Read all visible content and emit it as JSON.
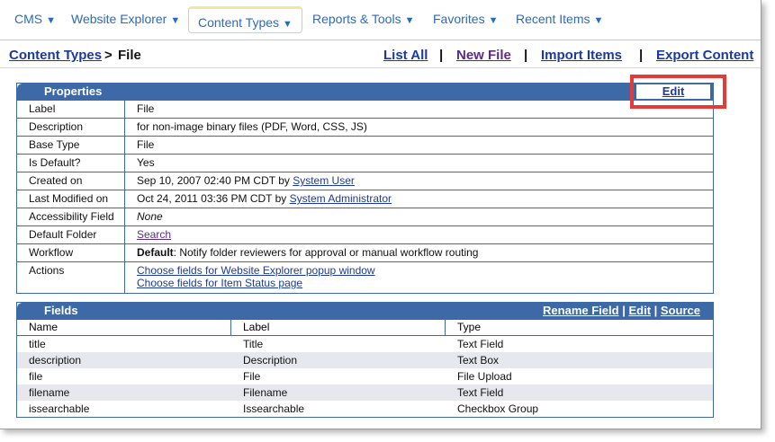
{
  "nav": {
    "items": [
      {
        "label": "CMS",
        "arrow": "▼"
      },
      {
        "label": "Website Explorer",
        "arrow": "▼"
      },
      {
        "label": "Content Types",
        "arrow": "▼"
      },
      {
        "label": "Reports & Tools",
        "arrow": "▼"
      },
      {
        "label": "Favorites",
        "arrow": "▼"
      },
      {
        "label": "Recent Items",
        "arrow": "▼"
      }
    ]
  },
  "breadcrumb": {
    "parent": "Content Types",
    "separator": ">",
    "current": "File"
  },
  "actions": {
    "list_all": "List All",
    "new_file": "New File",
    "import_items": "Import Items",
    "export_content": "Export Content",
    "sep": "|"
  },
  "properties": {
    "title": "Properties",
    "edit_label": "Edit",
    "rows": [
      {
        "label": "Label",
        "value": "File"
      },
      {
        "label": "Description",
        "value": "for non-image binary files (PDF, Word, CSS, JS)"
      },
      {
        "label": "Base Type",
        "value": "File"
      },
      {
        "label": "Is Default?",
        "value": "Yes"
      },
      {
        "label": "Created on",
        "value": "Sep 10, 2007 02:40 PM CDT by ",
        "link": "System User"
      },
      {
        "label": "Last Modified on",
        "value": "Oct 24, 2011 03:36 PM CDT by ",
        "link": "System Administrator"
      },
      {
        "label": "Accessibility Field",
        "value": "None"
      },
      {
        "label": "Default Folder",
        "link": "Search"
      },
      {
        "label": "Workflow",
        "bold": "Default",
        "value": ": Notify folder reviewers for approval or manual workflow routing"
      },
      {
        "label": "Actions",
        "link1": "Choose fields for Website Explorer popup window",
        "link2": "Choose fields for Item Status page"
      }
    ]
  },
  "fields": {
    "title": "Fields",
    "rename_field": "Rename Field",
    "edit": "Edit",
    "source": "Source",
    "sep": "|",
    "columns": [
      "Name",
      "Label",
      "Type"
    ],
    "rows": [
      {
        "name": "title",
        "label": "Title",
        "type": "Text Field"
      },
      {
        "name": "description",
        "label": "Description",
        "type": "Text Box"
      },
      {
        "name": "file",
        "label": "File",
        "type": "File Upload"
      },
      {
        "name": "filename",
        "label": "Filename",
        "type": "Text Field"
      },
      {
        "name": "issearchable",
        "label": "Issearchable",
        "type": "Checkbox Group"
      }
    ]
  },
  "colors": {
    "panel_header": "#3d6aa6",
    "nav_link": "#2a6bbf",
    "highlight": "#e53b36"
  }
}
